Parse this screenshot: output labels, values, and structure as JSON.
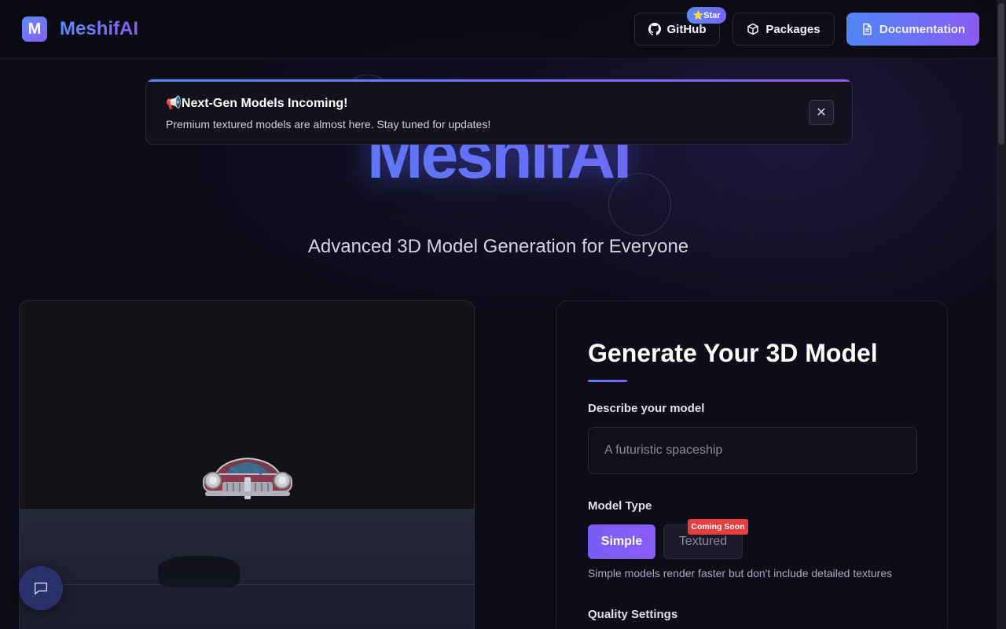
{
  "header": {
    "logo_letter": "M",
    "brand": "MeshifAI",
    "github_label": "GitHub",
    "star_badge": "⭐Star",
    "packages_label": "Packages",
    "docs_label": "Documentation"
  },
  "banner": {
    "icon": "📢",
    "title": "Next-Gen Models Incoming!",
    "text": "Premium textured models are almost here. Stay tuned for updates!",
    "close": "✕"
  },
  "hero": {
    "title": "MeshifAI",
    "subtitle": "Advanced 3D Model Generation for Everyone"
  },
  "form": {
    "title": "Generate Your 3D Model",
    "describe_label": "Describe your model",
    "describe_placeholder": "A futuristic spaceship",
    "model_type_label": "Model Type",
    "simple_label": "Simple",
    "textured_label": "Textured",
    "coming_soon": "Coming Soon",
    "hint": "Simple models render faster but don't include detailed textures",
    "quality_label": "Quality Settings"
  },
  "colors": {
    "accent_blue": "#4f86f7",
    "accent_purple": "#8a5cf6",
    "badge_red": "#e53e3e",
    "background": "#0c0c18"
  }
}
